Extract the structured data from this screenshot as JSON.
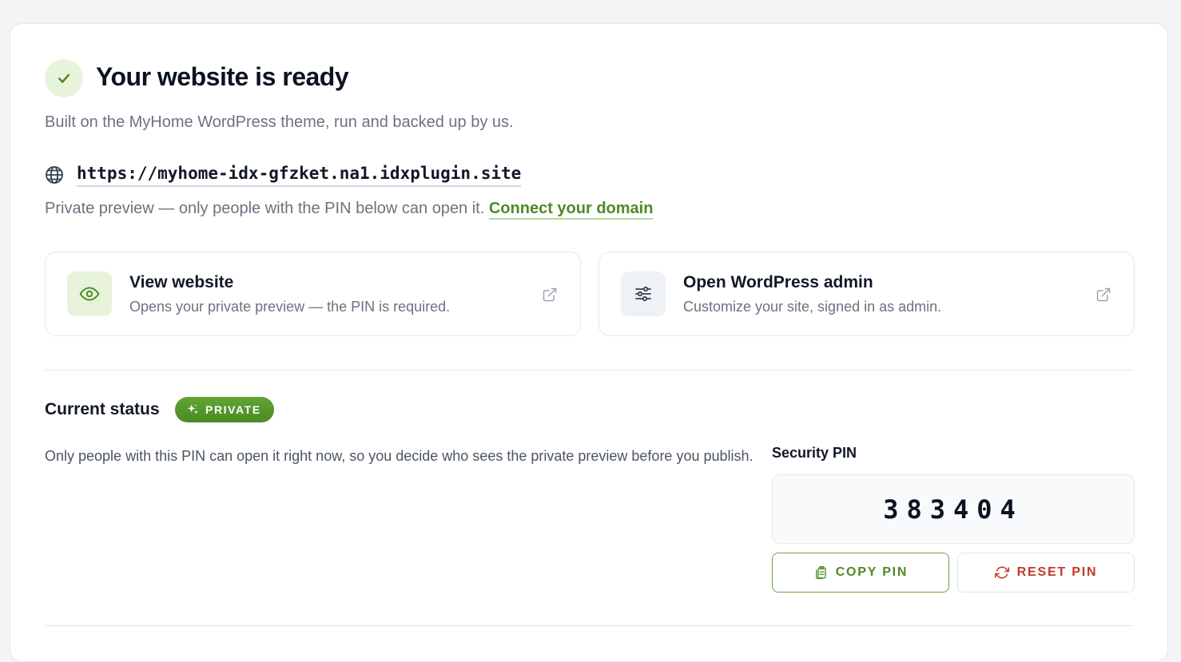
{
  "header": {
    "title": "Your website is ready",
    "subtitle": "Built on the MyHome WordPress theme, run and backed up by us."
  },
  "site": {
    "url": "https://myhome-idx-gfzket.na1.idxplugin.site",
    "preview_note": "Private preview — only people with the PIN below can open it.",
    "connect_link": "Connect your domain"
  },
  "actions": [
    {
      "title": "View website",
      "description": "Opens your private preview — the PIN is required.",
      "icon": "eye-icon"
    },
    {
      "title": "Open WordPress admin",
      "description": "Customize your site, signed in as admin.",
      "icon": "sliders-icon"
    }
  ],
  "status": {
    "label": "Current status",
    "badge": "PRIVATE",
    "description": "Only people with this PIN can open it right now, so you decide who sees the private preview before you publish."
  },
  "pin": {
    "label": "Security PIN",
    "value": "383404",
    "copy_label": "COPY PIN",
    "reset_label": "RESET PIN"
  },
  "colors": {
    "accent_green": "#4d8a26",
    "badge_green": "#5a9b2f",
    "danger_red": "#c0392b",
    "soft_green_bg": "#e8f3dc"
  }
}
